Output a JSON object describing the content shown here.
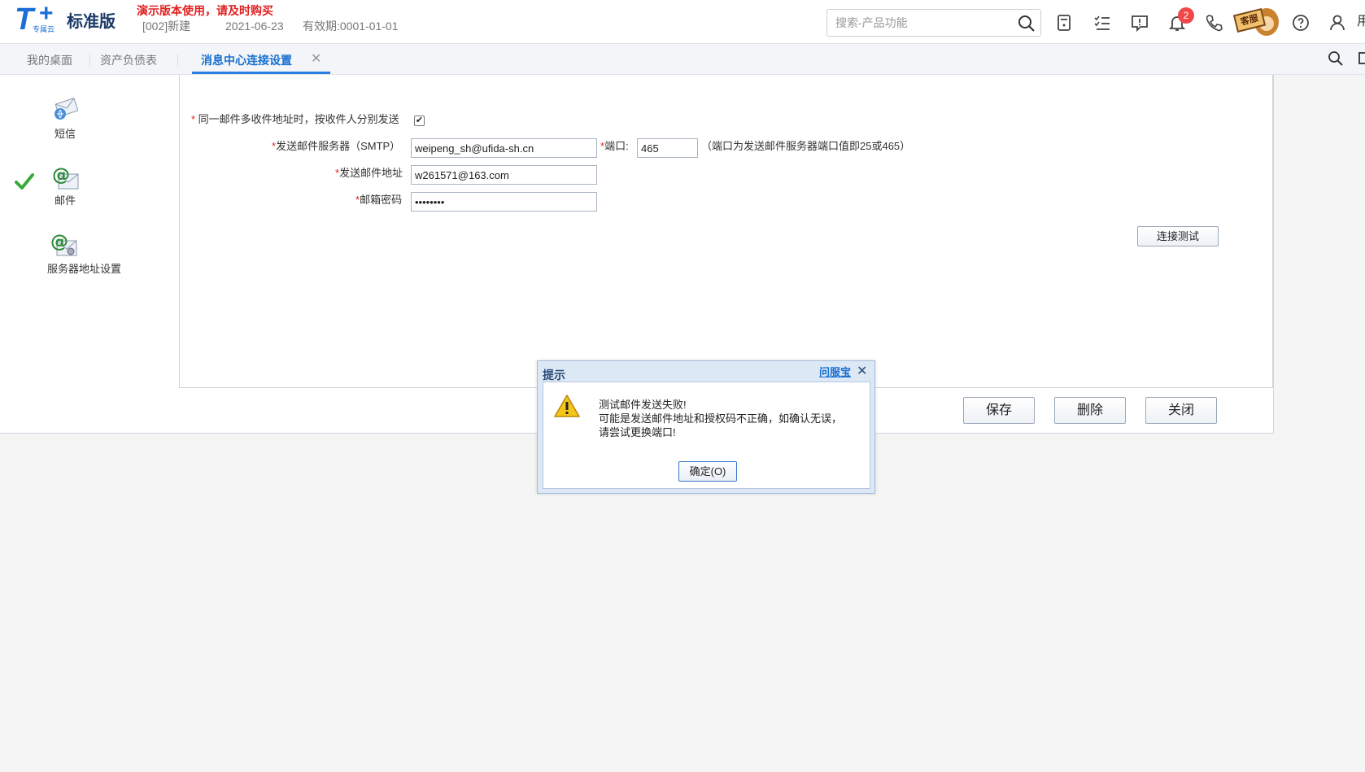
{
  "app": {
    "logo_sub": "专属云",
    "logo_name": "标准版",
    "demo_note": "演示版本使用，请及时购买",
    "account": "[002]新建",
    "date": "2021-06-23",
    "validity": "有效期:0001-01-01",
    "cut_text": "用"
  },
  "search": {
    "placeholder": "搜索-产品功能"
  },
  "header_icons": {
    "notification_count": "2",
    "mascot_label": "客服"
  },
  "tabs": [
    {
      "label": "我的桌面"
    },
    {
      "label": "资产负债表"
    },
    {
      "label": "消息中心连接设置",
      "active": true
    }
  ],
  "sidebar": {
    "items": [
      {
        "label": "短信"
      },
      {
        "label": "邮件",
        "selected": true
      },
      {
        "label": "服务器地址设置"
      }
    ]
  },
  "form": {
    "separate_send_label": "同一邮件多收件地址时，按收件人分别发送",
    "separate_send_checked": true,
    "smtp_label": "发送邮件服务器（SMTP）",
    "smtp_value": "weipeng_sh@ufida-sh.cn",
    "port_label": "端口:",
    "port_value": "465",
    "port_hint": "（端口为发送邮件服务器端口值即25或465）",
    "sender_label": "发送邮件地址",
    "sender_value": "w261571@163.com",
    "password_label": "邮箱密码",
    "password_value": "••••••••",
    "test_button": "连接测试"
  },
  "actions": {
    "save": "保存",
    "delete": "删除",
    "close": "关闭"
  },
  "dialog": {
    "title": "提示",
    "help_link": "问服宝",
    "message_line1": "测试邮件发送失败!",
    "message_line2": "可能是发送邮件地址和授权码不正确，如确认无误，",
    "message_line3": "请尝试更换端口!",
    "ok_button": "确定(O)"
  },
  "colors": {
    "accent": "#1a6fd0",
    "required": "#e02020",
    "badge": "#f04848"
  }
}
